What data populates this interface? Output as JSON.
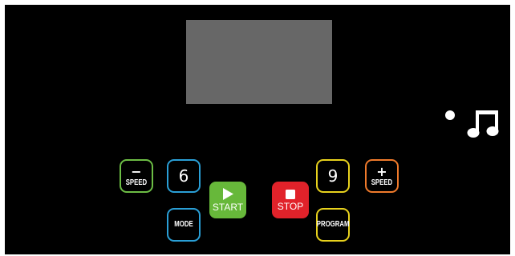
{
  "colors": {
    "background": "#000000",
    "display": "#676767",
    "speed_down": "#6cbd45",
    "number": "#2a9fd6",
    "start": "#67b83a",
    "stop": "#e1222a",
    "program": "#e8d21d",
    "speed_up": "#f07a2b"
  },
  "indicators": {
    "status_dot_icon": "dot-icon",
    "music_icon": "music-note-icon"
  },
  "controls": {
    "speed_down": {
      "sign": "−",
      "label": "SPEED",
      "icon": "minus-icon"
    },
    "preset_6": {
      "label": "6"
    },
    "mode": {
      "label": "MODE"
    },
    "start": {
      "label": "START",
      "icon": "play-icon"
    },
    "stop": {
      "label": "STOP",
      "icon": "stop-icon"
    },
    "preset_9": {
      "label": "9"
    },
    "program": {
      "label": "PROGRAM"
    },
    "speed_up": {
      "sign": "+",
      "label": "SPEED",
      "icon": "plus-icon"
    }
  }
}
